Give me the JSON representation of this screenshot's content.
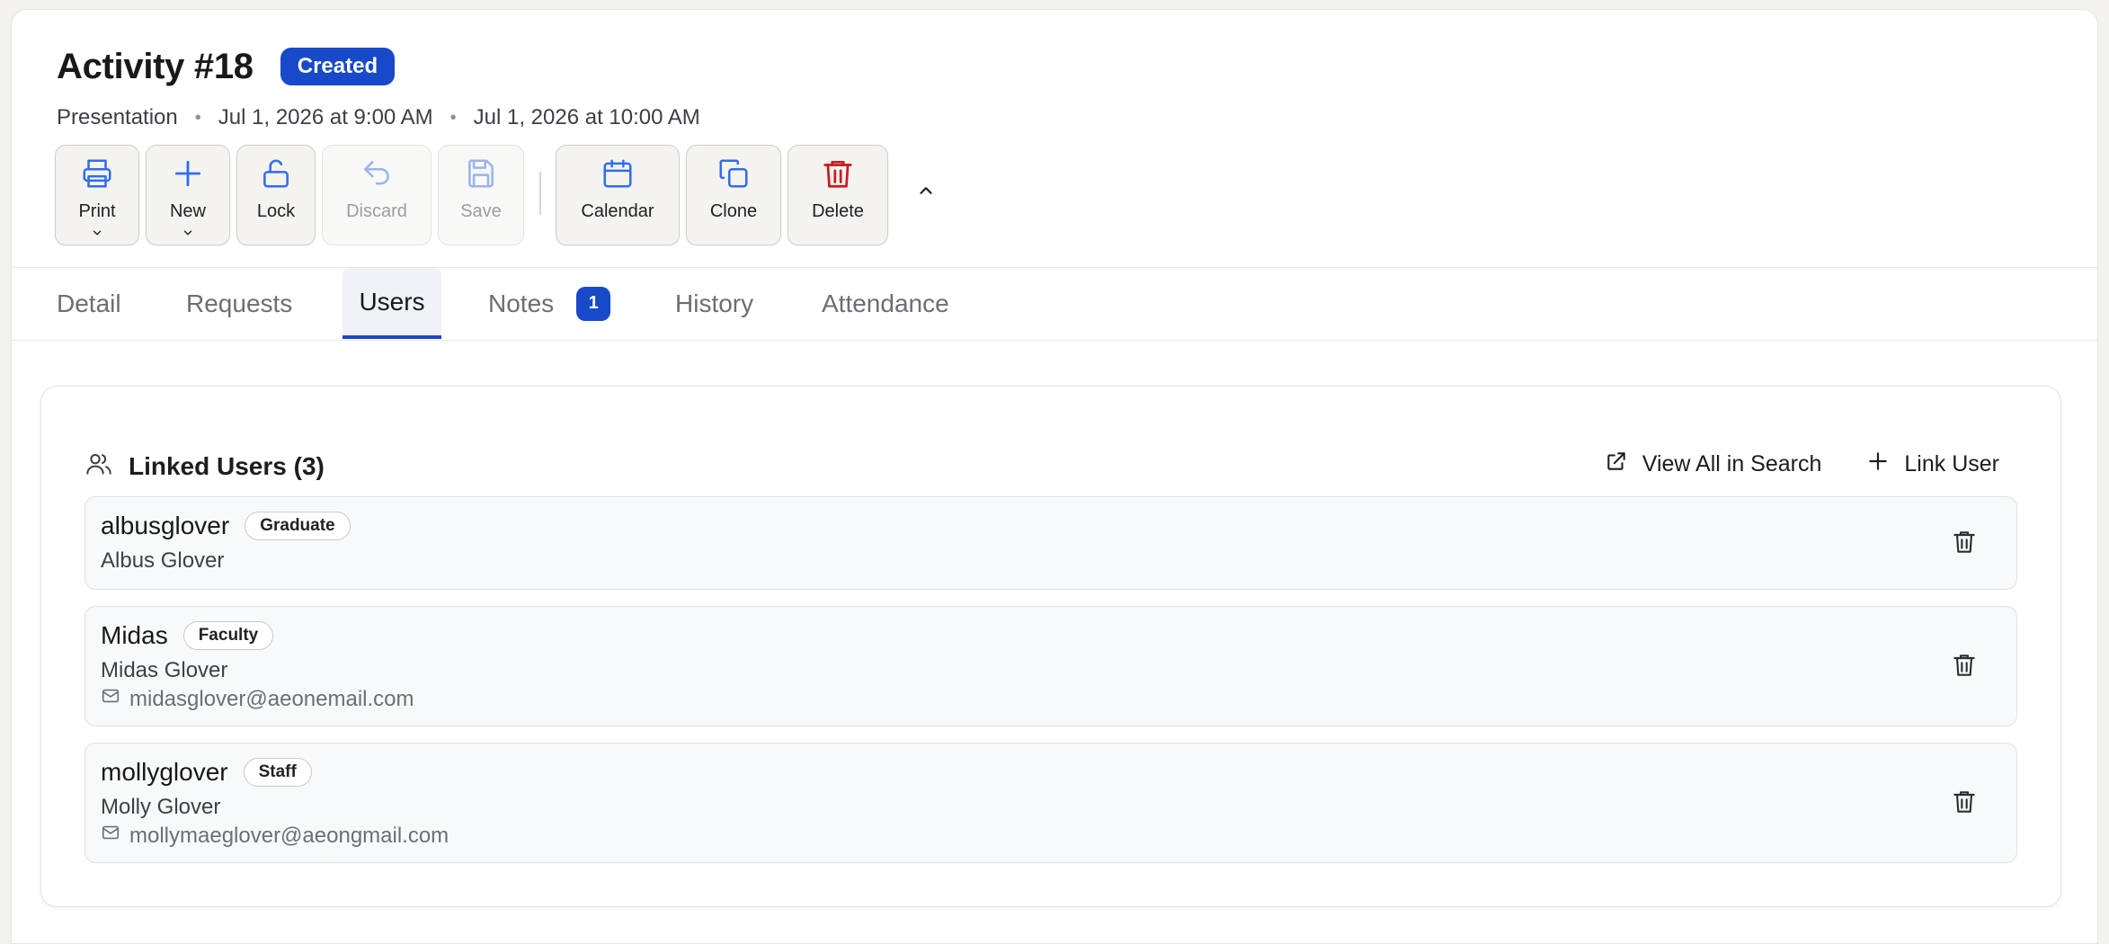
{
  "header": {
    "title": "Activity #18",
    "status": "Created",
    "type": "Presentation",
    "start": "Jul 1, 2026 at 9:00 AM",
    "end": "Jul 1, 2026 at 10:00 AM",
    "separator": "•"
  },
  "toolbar": {
    "print": "Print",
    "new": "New",
    "lock": "Lock",
    "discard": "Discard",
    "save": "Save",
    "calendar": "Calendar",
    "clone": "Clone",
    "delete": "Delete"
  },
  "tabs": {
    "detail": "Detail",
    "requests": "Requests",
    "users": "Users",
    "notes": "Notes",
    "notes_count": "1",
    "history": "History",
    "attendance": "Attendance"
  },
  "linked": {
    "title": "Linked Users (3)",
    "view_all": "View All in Search",
    "link_user": "Link User",
    "users": [
      {
        "username": "albusglover",
        "role": "Graduate",
        "full_name": "Albus Glover"
      },
      {
        "username": "Midas",
        "role": "Faculty",
        "full_name": "Midas Glover",
        "email": "midasglover@aeonemail.com"
      },
      {
        "username": "mollyglover",
        "role": "Staff",
        "full_name": "Molly Glover",
        "email": "mollymaeglover@aeongmail.com"
      }
    ]
  },
  "colors": {
    "accent": "#1849c8",
    "icon_blue": "#2f6df0",
    "delete_red": "#c8191f",
    "disabled": "#9ab3ea"
  }
}
